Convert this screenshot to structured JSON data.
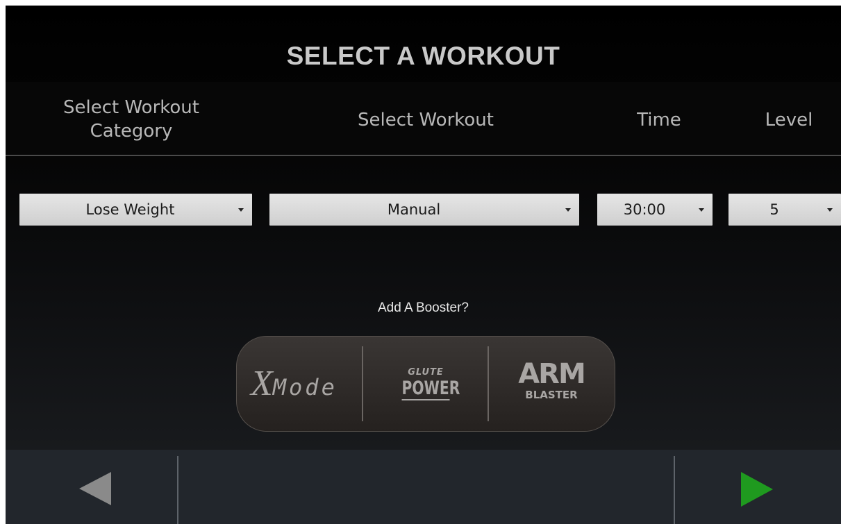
{
  "title": "SELECT A WORKOUT",
  "columns": {
    "category": "Select Workout\nCategory",
    "category_line1": "Select Workout",
    "category_line2": "Category",
    "workout": "Select Workout",
    "time": "Time",
    "level": "Level"
  },
  "selects": {
    "category": "Lose Weight",
    "workout": "Manual",
    "time": "30:00",
    "level": "5"
  },
  "booster": {
    "prompt": "Add A Booster?",
    "options": [
      {
        "name": "X Mode",
        "logo_x": "X",
        "logo_mode": "Mode"
      },
      {
        "name": "Glute Power",
        "logo_top": "GLUTE",
        "logo_bottom": "POWER"
      },
      {
        "name": "Arm Blaster",
        "logo_top": "ARM",
        "logo_bottom": "BLASTER"
      }
    ]
  },
  "footer": {
    "back_icon": "left-triangle-icon",
    "next_icon": "right-triangle-icon"
  },
  "colors": {
    "next_arrow": "#1f9a1f",
    "back_arrow": "#8a8a8a",
    "footer_bg": "#22262c"
  }
}
